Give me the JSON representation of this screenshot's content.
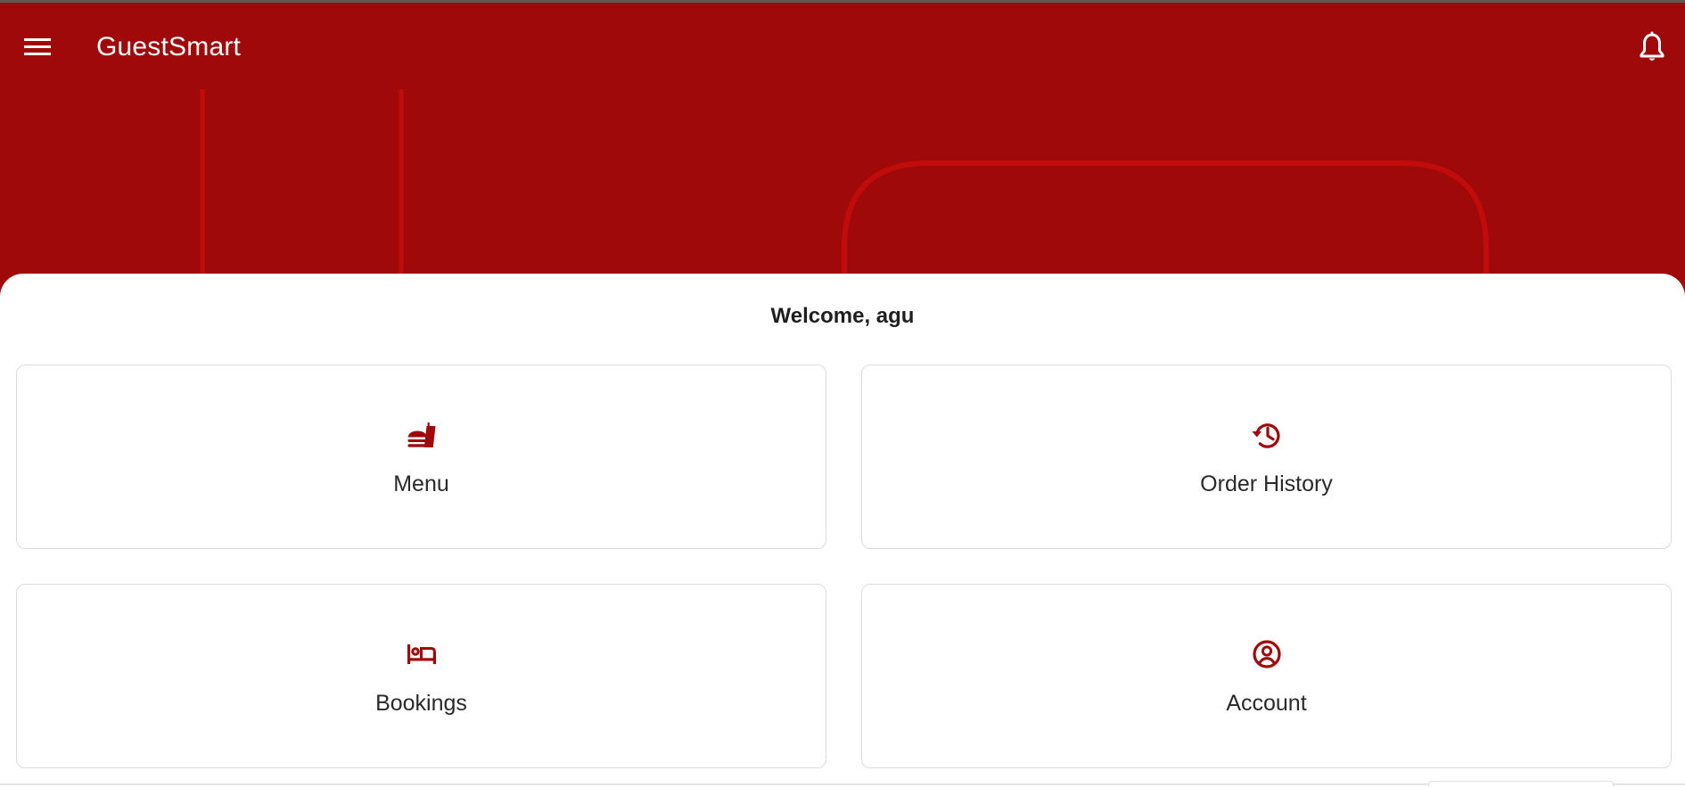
{
  "app": {
    "title": "GuestSmart"
  },
  "theme": {
    "primary": "#a00909",
    "deco_stroke": "#c20c0c",
    "icon_color": "#a00909"
  },
  "appbar": {
    "menu_icon": "hamburger-menu-icon",
    "notification_icon": "bell-icon"
  },
  "welcome": {
    "text": "Welcome, agu"
  },
  "cards": [
    {
      "label": "Menu",
      "icon": "fastfood-icon"
    },
    {
      "label": "Order History",
      "icon": "history-icon"
    },
    {
      "label": "Bookings",
      "icon": "bed-icon"
    },
    {
      "label": "Account",
      "icon": "account-circle-icon"
    }
  ]
}
